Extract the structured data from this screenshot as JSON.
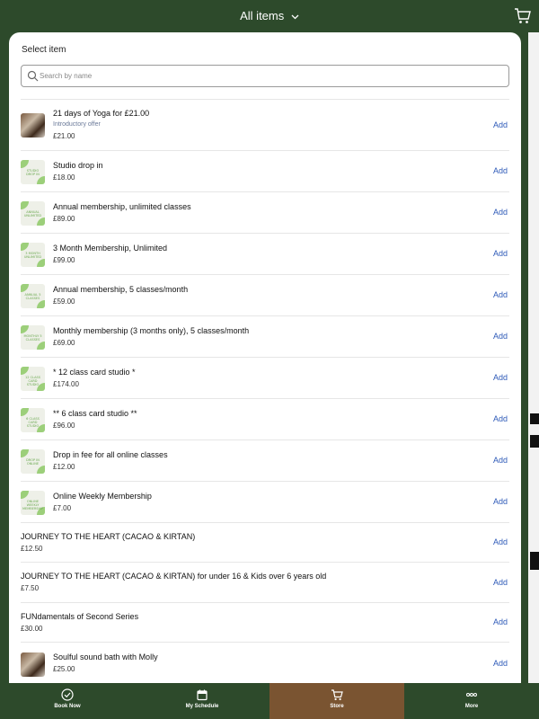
{
  "header": {
    "title": "All items"
  },
  "sheet": {
    "title": "Select item",
    "search_placeholder": "Search by name"
  },
  "items": [
    {
      "name": "21 days of Yoga for £21.00",
      "subtitle": "Introductory offer",
      "price": "£21.00",
      "thumb": "photo",
      "thumb_text": ""
    },
    {
      "name": "Studio drop in",
      "price": "£18.00",
      "thumb": "label",
      "thumb_text": "STUDIO DROP IN"
    },
    {
      "name": "Annual membership, unlimited classes",
      "price": "£89.00",
      "thumb": "label",
      "thumb_text": "ANNUAL UNLIMITED"
    },
    {
      "name": "3 Month Membership, Unlimited",
      "price": "£99.00",
      "thumb": "label",
      "thumb_text": "3 MONTH UNLIMITED"
    },
    {
      "name": "Annual membership, 5 classes/month",
      "price": "£59.00",
      "thumb": "label",
      "thumb_text": "ANNUAL 5 CLASSES"
    },
    {
      "name": "Monthly membership (3 months only), 5 classes/month",
      "price": "£69.00",
      "thumb": "label",
      "thumb_text": "MONTHLY 5 CLASSES"
    },
    {
      "name": "* 12 class card studio *",
      "price": "£174.00",
      "thumb": "label",
      "thumb_text": "12 CLASS CARD STUDIO"
    },
    {
      "name": "** 6 class card studio **",
      "price": "£96.00",
      "thumb": "label",
      "thumb_text": "6 CLASS CARD STUDIO"
    },
    {
      "name": "Drop in fee for all online classes",
      "price": "£12.00",
      "thumb": "label",
      "thumb_text": "DROP IN ONLINE"
    },
    {
      "name": "Online Weekly Membership",
      "price": "£7.00",
      "thumb": "label",
      "thumb_text": "ONLINE WEEKLY MEMBERSHIP"
    },
    {
      "name": "JOURNEY TO THE HEART (CACAO & KIRTAN)",
      "price": "£12.50",
      "thumb": "none",
      "thumb_text": ""
    },
    {
      "name": "JOURNEY TO THE HEART (CACAO & KIRTAN) for under 16 & Kids over 6 years old",
      "price": "£7.50",
      "thumb": "none",
      "thumb_text": ""
    },
    {
      "name": "FUNdamentals of Second Series",
      "price": "£30.00",
      "thumb": "none",
      "thumb_text": ""
    },
    {
      "name": "Soulful sound bath with Molly",
      "price": "£25.00",
      "thumb": "photo",
      "thumb_text": ""
    }
  ],
  "add_label": "Add",
  "nav": [
    {
      "label": "Book Now",
      "icon": "check-circle-icon",
      "active": false
    },
    {
      "label": "My Schedule",
      "icon": "calendar-icon",
      "active": false
    },
    {
      "label": "Store",
      "icon": "cart-icon",
      "active": true
    },
    {
      "label": "More",
      "icon": "more-dots-icon",
      "active": false
    }
  ],
  "colors": {
    "brand": "#2d4a2b",
    "active_tab": "#7a5431",
    "link": "#2e5ab8",
    "thumb_accent": "#9ccf7a"
  }
}
